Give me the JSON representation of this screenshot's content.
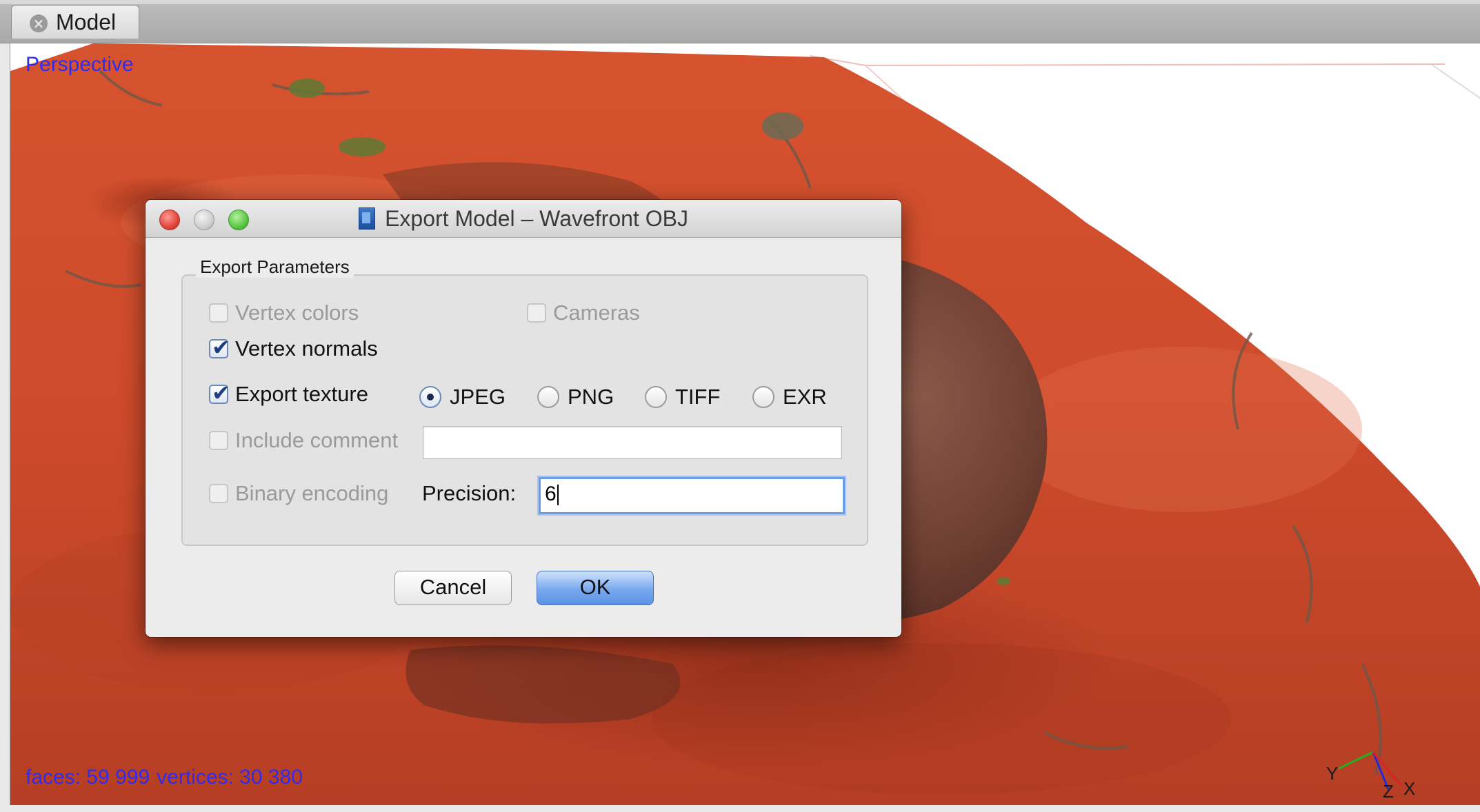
{
  "tab": {
    "label": "Model",
    "close_icon": "close-icon"
  },
  "viewport": {
    "view_label": "Perspective",
    "faces_text": "faces: 59 999",
    "vertices_text": "vertices: 30 380",
    "axes": {
      "x": "X",
      "y": "Y",
      "z": "Z"
    },
    "colors": {
      "overlay_text": "#2f2cf1",
      "terrain": "#c8472a",
      "rock": "#7a4638"
    }
  },
  "dialog": {
    "title": "Export Model – Wavefront OBJ",
    "group_title": "Export Parameters",
    "options": {
      "vertex_colors": {
        "label": "Vertex colors",
        "checked": false,
        "enabled": false
      },
      "cameras": {
        "label": "Cameras",
        "checked": false,
        "enabled": false
      },
      "vertex_normals": {
        "label": "Vertex normals",
        "checked": true,
        "enabled": true
      },
      "export_texture": {
        "label": "Export texture",
        "checked": true,
        "enabled": true
      },
      "include_comment": {
        "label": "Include comment",
        "checked": false,
        "enabled": false
      },
      "binary_encoding": {
        "label": "Binary encoding",
        "checked": false,
        "enabled": false
      }
    },
    "texture_formats": [
      {
        "label": "JPEG",
        "selected": true
      },
      {
        "label": "PNG",
        "selected": false
      },
      {
        "label": "TIFF",
        "selected": false
      },
      {
        "label": "EXR",
        "selected": false
      }
    ],
    "comment_value": "",
    "precision": {
      "label": "Precision:",
      "value": "6"
    },
    "buttons": {
      "cancel": "Cancel",
      "ok": "OK"
    }
  }
}
